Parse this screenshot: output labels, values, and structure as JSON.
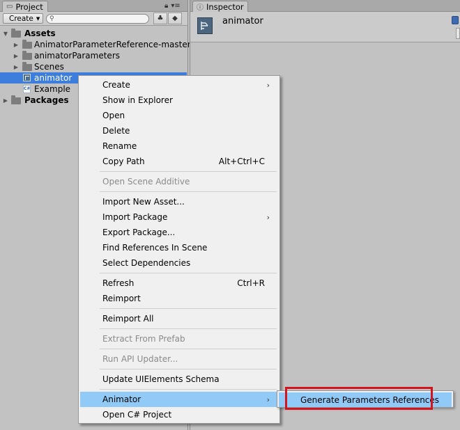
{
  "project": {
    "tab_title": "Project",
    "create_label": "Create",
    "tree": [
      {
        "label": "Assets",
        "bold": true
      },
      {
        "label": "AnimatorParameterReference-master"
      },
      {
        "label": "animatorParameters"
      },
      {
        "label": "Scenes"
      },
      {
        "label": "animator",
        "selected": true,
        "icon": "animator-controller-icon"
      },
      {
        "label": "Example",
        "icon": "csharp-script-icon"
      },
      {
        "label": "Packages",
        "bold": true
      }
    ]
  },
  "inspector": {
    "tab_title": "Inspector",
    "asset_name": "animator"
  },
  "context_menu": {
    "create": "Create",
    "show_in_explorer": "Show in Explorer",
    "open": "Open",
    "delete": "Delete",
    "rename": "Rename",
    "copy_path": "Copy Path",
    "copy_path_shortcut": "Alt+Ctrl+C",
    "open_scene_additive": "Open Scene Additive",
    "import_new_asset": "Import New Asset...",
    "import_package": "Import Package",
    "export_package": "Export Package...",
    "find_references": "Find References In Scene",
    "select_dependencies": "Select Dependencies",
    "refresh": "Refresh",
    "refresh_shortcut": "Ctrl+R",
    "reimport": "Reimport",
    "reimport_all": "Reimport All",
    "extract_from_prefab": "Extract From Prefab",
    "run_api_updater": "Run API Updater...",
    "update_uielements": "Update UIElements Schema",
    "animator": "Animator",
    "open_csharp_project": "Open C# Project"
  },
  "submenu": {
    "generate": "Generate Parameters References"
  },
  "colors": {
    "highlight": "#91c9f7",
    "selection": "#3d7ddb",
    "callout": "#d3141e"
  }
}
